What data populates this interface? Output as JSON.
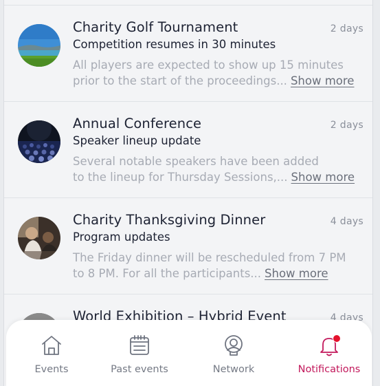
{
  "notifications": [
    {
      "title": "Charity Golf Tournament",
      "time": "2 days",
      "subtitle": "Competition resumes in 30 minutes",
      "body_line1": "All players are expected to show up 15 minutes",
      "body_line2": "prior to the start of the proceedings...",
      "show_more": "Show more"
    },
    {
      "title": "Annual Conference",
      "time": "2 days",
      "subtitle": "Speaker lineup update",
      "body_line1": "Several notable speakers have been added",
      "body_line2": "to the lineup for Thursday Sessions,...",
      "show_more": "Show more"
    },
    {
      "title": "Charity Thanksgiving Dinner",
      "time": "4 days",
      "subtitle": "Program updates",
      "body_line1": "The Friday dinner will be rescheduled from 7 PM",
      "body_line2": "to 8 PM. For all the participants...",
      "show_more": "Show more"
    },
    {
      "title": "World Exhibition – Hybrid Event",
      "time": "4 days"
    }
  ],
  "tabbar": {
    "tabs": [
      {
        "label": "Events",
        "icon": "home-icon"
      },
      {
        "label": "Past events",
        "icon": "calendar-icon"
      },
      {
        "label": "Network",
        "icon": "network-icon"
      },
      {
        "label": "Notifications",
        "icon": "bell-icon",
        "active": true
      }
    ]
  },
  "colors": {
    "accent": "#c2185b",
    "badge": "#e5122d",
    "text_primary": "#1d2233",
    "text_muted": "#a7abb4"
  }
}
